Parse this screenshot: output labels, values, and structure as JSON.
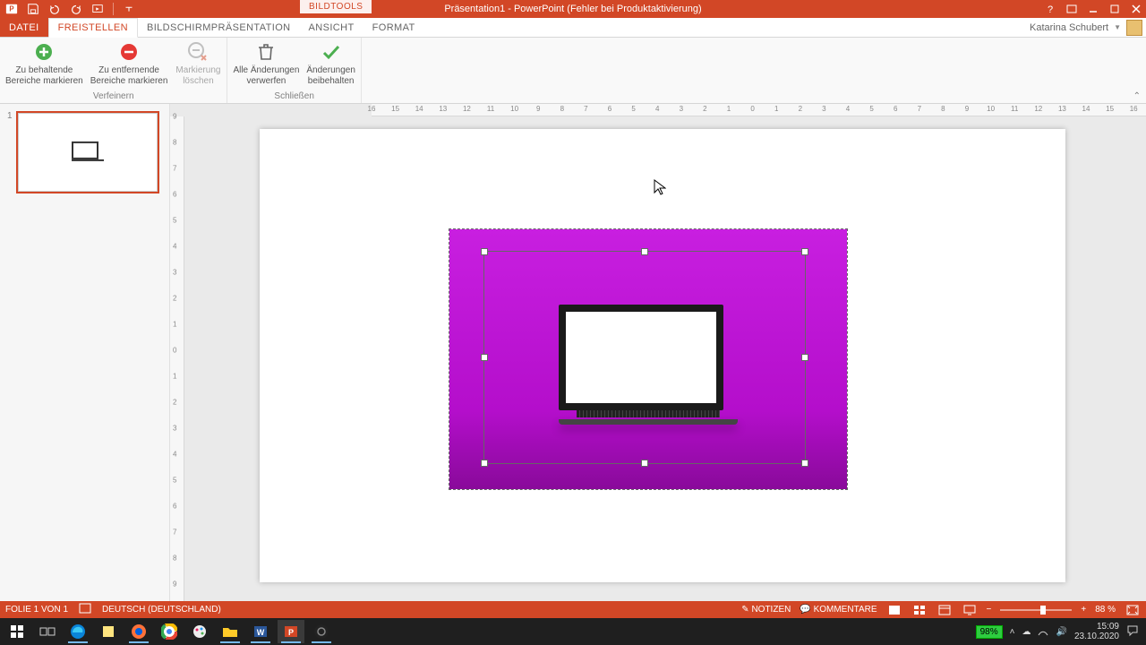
{
  "titlebar": {
    "contextual_tools": "BILDTOOLS",
    "title": "Präsentation1 - PowerPoint (Fehler bei Produktaktivierung)"
  },
  "tabs": {
    "file": "DATEI",
    "items": [
      "FREISTELLEN",
      "BILDSCHIRMPRÄSENTATION",
      "ANSICHT",
      "FORMAT"
    ],
    "active": "FREISTELLEN",
    "account_name": "Katarina Schubert"
  },
  "ribbon": {
    "group1_label": "Verfeinern",
    "group2_label": "Schließen",
    "btn1": "Zu behaltende\nBereiche markieren",
    "btn2": "Zu entfernende\nBereiche markieren",
    "btn3": "Markierung\nlöschen",
    "btn4": "Alle Änderungen\nverwerfen",
    "btn5": "Änderungen\nbeibehalten"
  },
  "slidepanel": {
    "slide_number": "1"
  },
  "ruler_h": [
    "16",
    "15",
    "14",
    "13",
    "12",
    "11",
    "10",
    "9",
    "8",
    "7",
    "6",
    "5",
    "4",
    "3",
    "2",
    "1",
    "0",
    "1",
    "2",
    "3",
    "4",
    "5",
    "6",
    "7",
    "8",
    "9",
    "10",
    "11",
    "12",
    "13",
    "14",
    "15",
    "16"
  ],
  "ruler_v": [
    "9",
    "8",
    "7",
    "6",
    "5",
    "4",
    "3",
    "2",
    "1",
    "0",
    "1",
    "2",
    "3",
    "4",
    "5",
    "6",
    "7",
    "8",
    "9"
  ],
  "statusbar": {
    "slide_info": "FOLIE 1 VON 1",
    "language": "DEUTSCH (DEUTSCHLAND)",
    "notes": "NOTIZEN",
    "comments": "KOMMENTARE",
    "zoom": "88 %"
  },
  "taskbar": {
    "battery": "98%",
    "time": "15:09",
    "date": "23.10.2020"
  }
}
